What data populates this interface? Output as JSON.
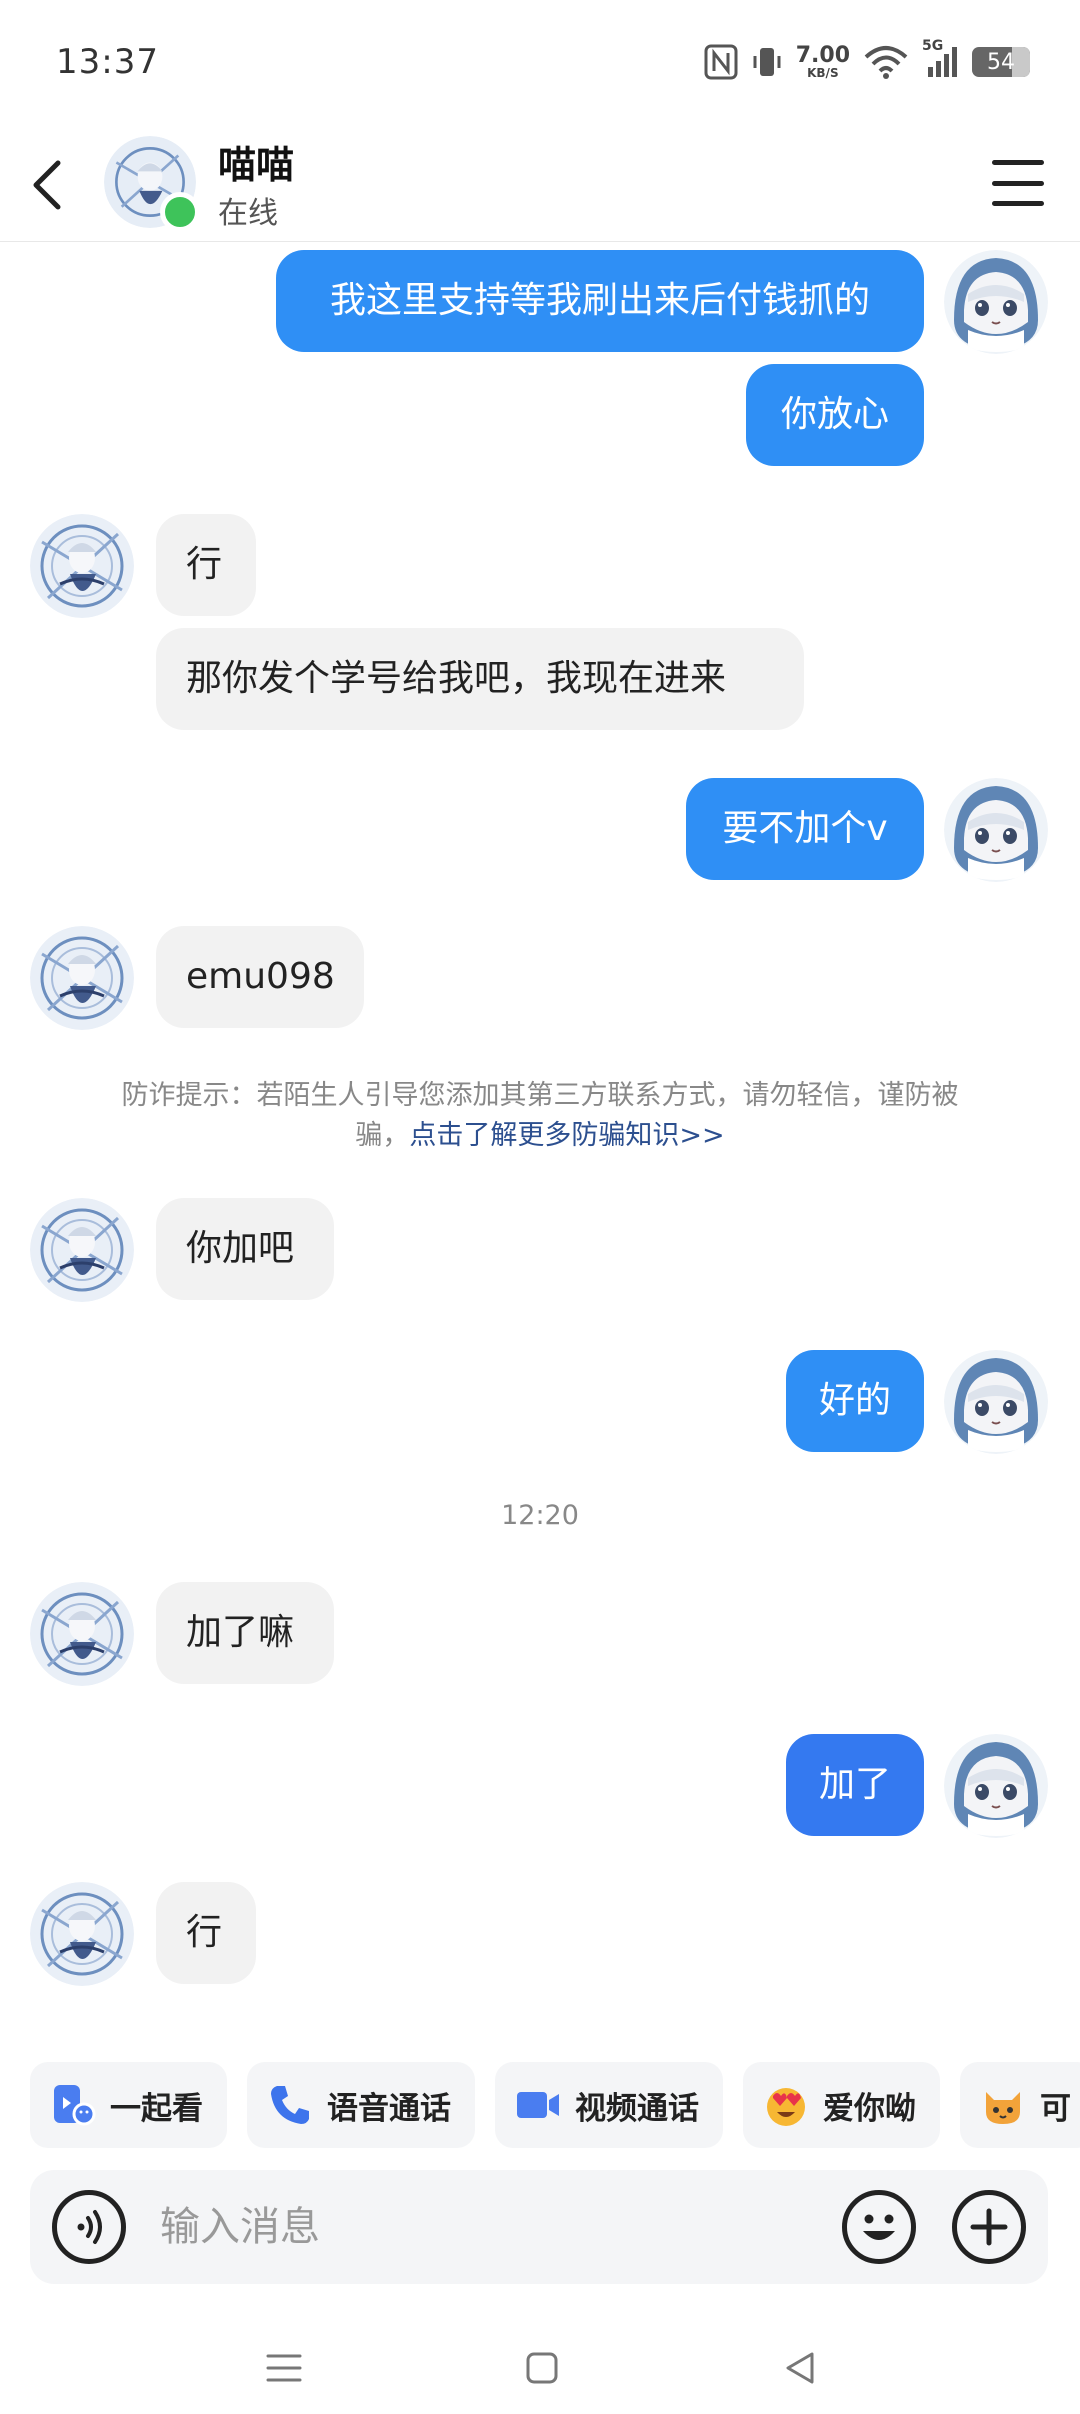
{
  "status_bar": {
    "time": "13:37",
    "net_speed": "7.00",
    "net_unit": "KB/S",
    "network": "5G",
    "battery": "54"
  },
  "header": {
    "name": "喵喵",
    "status": "在线"
  },
  "messages": [
    {
      "dir": "out",
      "text": "我这里支持等我刷出来后付钱抓的"
    },
    {
      "dir": "out",
      "text": "你放心"
    },
    {
      "dir": "in",
      "text": "行"
    },
    {
      "dir": "in",
      "text": "那你发个学号给我吧，我现在进来"
    },
    {
      "dir": "out",
      "text": "要不加个v"
    },
    {
      "dir": "in",
      "text": "emu098"
    },
    {
      "dir": "in",
      "text": "你加吧"
    },
    {
      "dir": "out",
      "text": "好的"
    },
    {
      "dir": "in",
      "text": "加了嘛"
    },
    {
      "dir": "out",
      "text": "加了"
    },
    {
      "dir": "in",
      "text": "行"
    }
  ],
  "warning": {
    "text": "防诈提示：若陌生人引导您添加其第三方联系方式，请勿轻信，谨防被骗，",
    "link": "点击了解更多防骗知识>>"
  },
  "timestamp": "12:20",
  "quick_actions": [
    {
      "label": "一起看",
      "icon": "watch-together-icon"
    },
    {
      "label": "语音通话",
      "icon": "phone-icon"
    },
    {
      "label": "视频通话",
      "icon": "video-camera-icon"
    },
    {
      "label": "爱你呦",
      "icon": "heart-eyes-emoji-icon"
    },
    {
      "label": "可",
      "icon": "cat-emoji-icon"
    }
  ],
  "input": {
    "placeholder": "输入消息"
  },
  "colors": {
    "bubble_out": "#2f8ff5",
    "bubble_in": "#f2f2f2",
    "online": "#3ec35a",
    "link": "#2c4f8f"
  }
}
